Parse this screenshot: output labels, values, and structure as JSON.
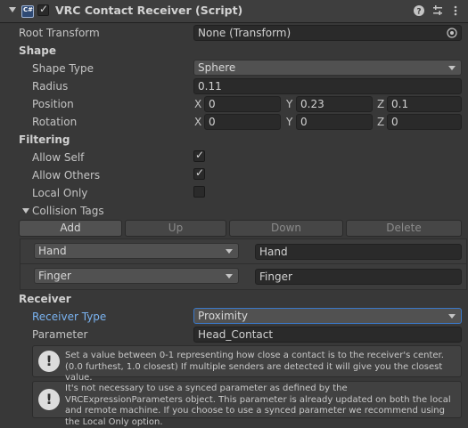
{
  "header": {
    "title": "VRC Contact Receiver (Script)",
    "enabled": true
  },
  "root_transform": {
    "label": "Root Transform",
    "value": "None (Transform)"
  },
  "shape": {
    "section_label": "Shape",
    "shape_type": {
      "label": "Shape Type",
      "value": "Sphere"
    },
    "radius": {
      "label": "Radius",
      "value": "0.11"
    },
    "position": {
      "label": "Position",
      "x": "0",
      "y": "0.23",
      "z": "0.1"
    },
    "rotation": {
      "label": "Rotation",
      "x": "0",
      "y": "0",
      "z": "0"
    },
    "axis": {
      "x": "X",
      "y": "Y",
      "z": "Z"
    }
  },
  "filtering": {
    "section_label": "Filtering",
    "allow_self": {
      "label": "Allow Self",
      "checked": true
    },
    "allow_others": {
      "label": "Allow Others",
      "checked": true
    },
    "local_only": {
      "label": "Local Only",
      "checked": false
    },
    "collision_tags": {
      "label": "Collision Tags",
      "buttons": {
        "add": "Add",
        "up": "Up",
        "down": "Down",
        "delete": "Delete"
      },
      "tags": [
        {
          "dropdown": "Hand",
          "value": "Hand"
        },
        {
          "dropdown": "Finger",
          "value": "Finger"
        }
      ]
    }
  },
  "receiver": {
    "section_label": "Receiver",
    "receiver_type": {
      "label": "Receiver Type",
      "value": "Proximity"
    },
    "parameter": {
      "label": "Parameter",
      "value": "Head_Contact"
    }
  },
  "help": {
    "proximity": "Set a value between 0-1 representing how close a contact is to the receiver's center. (0.0 furthest, 1.0 closest)  If multiple senders are detected it will give you the closest value.",
    "synced": "It's not necessary to use a synced parameter as defined by the VRCExpressionParameters object.  This parameter is already updated on both the local and remote machine.  If you choose to use a synced parameter we recommend using the Local Only option."
  },
  "icons": {
    "expand": "triangle-down-icon",
    "script": "cs-script-icon",
    "help": "help-icon",
    "presets": "presets-icon",
    "more": "kebab-menu-icon",
    "object_picker": "object-picker-icon",
    "info": "info-icon"
  }
}
